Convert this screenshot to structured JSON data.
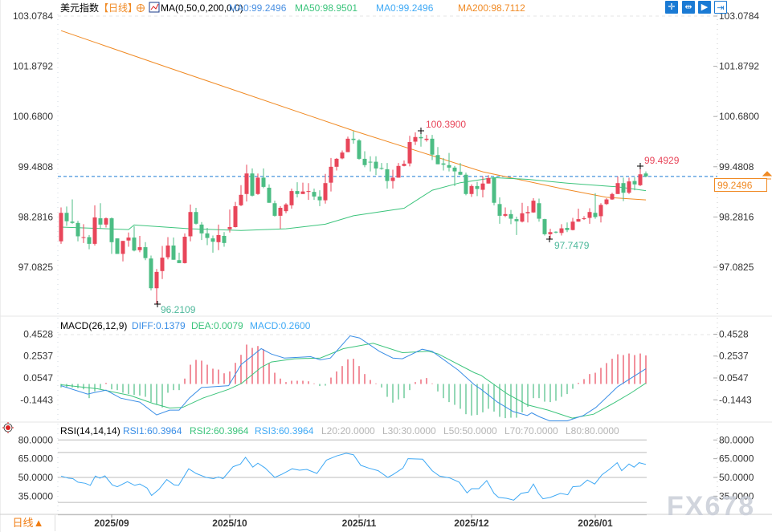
{
  "header": {
    "symbol": "美元指数",
    "period_tag": "【日线】",
    "ma_label": "MA(0,50,0,200,0,0)",
    "ma0": "MA0:99.2496",
    "ma50": "MA50:98.9501",
    "ma0b": "MA0:99.2496",
    "ma200": "MA200:98.7112"
  },
  "toolbar": {
    "icons": [
      "crosshair-icon",
      "fit-range-icon",
      "zoom-right-icon",
      "jump-latest-icon"
    ]
  },
  "colors": {
    "up": "#e8465a",
    "down": "#4cbd84",
    "ma50": "#3cc47c",
    "ma200": "#f08a24",
    "diff": "#3a8ee6",
    "dea": "#3cc47c",
    "rsi": "#3fa9f5",
    "price_line": "#1a7ad4"
  },
  "price_axis": {
    "labels": [
      "103.0784",
      "101.8792",
      "100.6800",
      "99.4808",
      "98.2816",
      "97.0825"
    ],
    "values": [
      103.0784,
      101.8792,
      100.68,
      99.4808,
      98.2816,
      97.0825
    ]
  },
  "current_price": "99.2496",
  "annotations": {
    "high": "100.3900",
    "low": "96.2109",
    "recent_high": "99.4929",
    "recent_low": "97.7479"
  },
  "macd": {
    "title": "MACD(26,12,9)",
    "diff_label": "DIFF:0.1379",
    "dea_label": "DEA:0.0079",
    "macd_label": "MACD:0.2600",
    "axis": {
      "labels": [
        "0.4528",
        "0.2537",
        "0.0547",
        "-0.1443"
      ],
      "values": [
        0.4528,
        0.2537,
        0.0547,
        -0.1443
      ]
    }
  },
  "rsi": {
    "title": "RSI(14,14,14)",
    "rsi1": "RSI1:60.3964",
    "rsi2": "RSI2:60.3964",
    "rsi3": "RSI3:60.3964",
    "l20": "L20:20.0000",
    "l30": "L30:30.0000",
    "l50": "L50:50.0000",
    "l70": "L70:70.0000",
    "l80": "L80:80.0000",
    "axis": {
      "labels": [
        "80.0000",
        "65.0000",
        "50.0000",
        "35.0000"
      ],
      "values": [
        80,
        65,
        50,
        35
      ]
    },
    "levels": [
      80,
      70,
      50,
      30,
      20
    ]
  },
  "footer": {
    "period": "日线",
    "period_arrow": "▲"
  },
  "date_ticks": [
    {
      "label": "2025/09",
      "index": 10
    },
    {
      "label": "2025/10",
      "index": 31
    },
    {
      "label": "2025/11",
      "index": 54
    },
    {
      "label": "2025/12",
      "index": 74
    },
    {
      "label": "2026/01",
      "index": 96
    }
  ],
  "watermark": "FX678",
  "chart_data": {
    "type": "candlestick",
    "ylim": [
      96.0,
      103.0784
    ],
    "candles_ohlc": [
      [
        97.7,
        98.51,
        97.64,
        98.38
      ],
      [
        98.38,
        98.53,
        98.07,
        98.18
      ],
      [
        98.17,
        98.7,
        98.12,
        98.14
      ],
      [
        98.14,
        98.19,
        97.7,
        97.82
      ],
      [
        97.8,
        98.11,
        97.66,
        97.8
      ],
      [
        97.8,
        97.85,
        97.51,
        97.64
      ],
      [
        97.64,
        98.56,
        97.6,
        98.27
      ],
      [
        98.25,
        98.61,
        98.0,
        98.1
      ],
      [
        98.1,
        98.27,
        98.03,
        98.25
      ],
      [
        98.25,
        98.27,
        97.4,
        97.68
      ],
      [
        97.77,
        97.77,
        97.4,
        97.4
      ],
      [
        97.4,
        97.71,
        97.22,
        97.71
      ],
      [
        97.72,
        97.91,
        97.57,
        97.79
      ],
      [
        97.79,
        98.06,
        97.46,
        97.48
      ],
      [
        97.49,
        97.83,
        97.44,
        97.56
      ],
      [
        97.56,
        97.68,
        97.25,
        97.3
      ],
      [
        97.29,
        97.36,
        96.53,
        96.58
      ],
      [
        96.58,
        97.04,
        96.21,
        96.97
      ],
      [
        96.99,
        97.59,
        96.8,
        97.31
      ],
      [
        97.32,
        97.8,
        97.27,
        97.6
      ],
      [
        97.6,
        97.79,
        97.26,
        97.26
      ],
      [
        97.25,
        97.43,
        97.18,
        97.18
      ],
      [
        97.18,
        97.89,
        97.17,
        97.81
      ],
      [
        97.82,
        98.58,
        97.7,
        98.4
      ],
      [
        98.4,
        98.5,
        98.1,
        98.12
      ],
      [
        98.1,
        98.16,
        97.73,
        97.89
      ],
      [
        97.89,
        98.02,
        97.61,
        97.78
      ],
      [
        97.77,
        97.84,
        97.43,
        97.69
      ],
      [
        97.68,
        98.1,
        97.49,
        97.85
      ],
      [
        97.83,
        97.92,
        97.57,
        97.66
      ],
      [
        97.99,
        98.46,
        97.91,
        98.04
      ],
      [
        98.04,
        98.64,
        98.03,
        98.54
      ],
      [
        98.56,
        99.04,
        98.54,
        98.81
      ],
      [
        98.83,
        99.53,
        98.65,
        99.32
      ],
      [
        99.32,
        99.44,
        98.77,
        98.79
      ],
      [
        98.83,
        99.32,
        98.81,
        99.22
      ],
      [
        99.22,
        99.44,
        98.97,
        99.0
      ],
      [
        98.98,
        99.06,
        98.62,
        98.62
      ],
      [
        98.61,
        98.67,
        98.29,
        98.31
      ],
      [
        98.31,
        98.54,
        98.0,
        98.5
      ],
      [
        98.42,
        98.61,
        98.37,
        98.58
      ],
      [
        98.56,
        98.96,
        98.48,
        98.9
      ],
      [
        98.9,
        99.11,
        98.75,
        98.83
      ],
      [
        98.83,
        99.1,
        98.83,
        98.89
      ],
      [
        98.88,
        99.09,
        98.69,
        98.9
      ],
      [
        98.88,
        98.96,
        98.69,
        98.77
      ],
      [
        98.77,
        98.92,
        98.54,
        98.68
      ],
      [
        98.68,
        99.31,
        98.6,
        99.09
      ],
      [
        99.1,
        99.69,
        98.89,
        99.48
      ],
      [
        99.48,
        99.69,
        99.39,
        99.67
      ],
      [
        99.68,
        99.87,
        99.66,
        99.82
      ],
      [
        99.83,
        100.2,
        99.83,
        100.15
      ],
      [
        100.15,
        100.33,
        100.03,
        100.12
      ],
      [
        100.11,
        100.14,
        99.65,
        99.67
      ],
      [
        99.67,
        99.85,
        99.47,
        99.52
      ],
      [
        99.6,
        99.73,
        99.37,
        99.59
      ],
      [
        99.6,
        99.73,
        99.28,
        99.44
      ],
      [
        99.45,
        99.57,
        99.41,
        99.43
      ],
      [
        99.42,
        99.57,
        98.96,
        99.14
      ],
      [
        99.14,
        99.41,
        98.96,
        99.22
      ],
      [
        99.22,
        99.57,
        99.22,
        99.5
      ],
      [
        99.5,
        99.63,
        99.49,
        99.55
      ],
      [
        99.56,
        100.22,
        99.49,
        100.07
      ],
      [
        100.08,
        100.3,
        100.0,
        100.19
      ],
      [
        100.19,
        100.39,
        99.96,
        100.16
      ],
      [
        100.12,
        100.24,
        100.08,
        100.15
      ],
      [
        100.15,
        100.24,
        99.64,
        99.77
      ],
      [
        99.76,
        99.95,
        99.54,
        99.54
      ],
      [
        99.56,
        99.69,
        99.39,
        99.53
      ],
      [
        99.52,
        99.81,
        99.37,
        99.46
      ],
      [
        99.46,
        99.5,
        99.02,
        99.37
      ],
      [
        99.36,
        99.57,
        99.28,
        99.29
      ],
      [
        99.29,
        99.34,
        98.8,
        98.83
      ],
      [
        98.83,
        99.06,
        98.76,
        99.02
      ],
      [
        99.02,
        99.12,
        98.78,
        98.95
      ],
      [
        98.93,
        99.25,
        98.75,
        99.08
      ],
      [
        99.08,
        99.28,
        99.08,
        99.21
      ],
      [
        99.21,
        99.23,
        98.56,
        98.62
      ],
      [
        98.59,
        98.75,
        98.12,
        98.31
      ],
      [
        98.31,
        98.51,
        98.28,
        98.35
      ],
      [
        98.35,
        98.45,
        98.11,
        98.24
      ],
      [
        98.23,
        98.29,
        97.85,
        98.18
      ],
      [
        98.17,
        98.62,
        98.15,
        98.37
      ],
      [
        98.37,
        98.54,
        98.15,
        98.4
      ],
      [
        98.39,
        98.73,
        98.38,
        98.67
      ],
      [
        98.61,
        98.72,
        98.17,
        98.24
      ],
      [
        98.23,
        98.24,
        97.84,
        97.87
      ],
      [
        97.87,
        98.0,
        97.7479,
        97.92
      ],
      [
        97.93,
        97.94,
        97.89,
        97.91
      ],
      [
        97.9,
        98.11,
        97.84,
        98.01
      ],
      [
        98.02,
        98.15,
        97.92,
        97.97
      ],
      [
        97.97,
        98.26,
        97.96,
        98.17
      ],
      [
        98.17,
        98.48,
        98.17,
        98.23
      ],
      [
        98.23,
        98.3,
        98.21,
        98.25
      ],
      [
        98.26,
        98.49,
        98.12,
        98.4
      ],
      [
        98.38,
        98.85,
        98.24,
        98.28
      ],
      [
        98.3,
        98.61,
        98.15,
        98.57
      ],
      [
        98.59,
        98.73,
        98.57,
        98.7
      ],
      [
        98.7,
        98.86,
        98.69,
        98.83
      ],
      [
        98.83,
        99.25,
        98.83,
        99.09
      ],
      [
        99.09,
        99.22,
        98.66,
        98.86
      ],
      [
        98.86,
        99.22,
        98.83,
        99.13
      ],
      [
        99.14,
        99.23,
        98.92,
        99.06
      ],
      [
        99.04,
        99.4929,
        99.02,
        99.3
      ],
      [
        99.32,
        99.37,
        99.23,
        99.2496
      ]
    ],
    "ma50_points": [
      [
        1,
        98.04
      ],
      [
        13,
        97.98
      ],
      [
        14,
        98.09
      ],
      [
        24,
        98.0
      ],
      [
        33,
        97.96
      ],
      [
        41,
        98.0
      ],
      [
        48,
        98.11
      ],
      [
        53,
        98.31
      ],
      [
        62,
        98.49
      ],
      [
        67,
        98.92
      ],
      [
        72,
        99.1
      ],
      [
        78,
        99.22
      ],
      [
        84,
        99.18
      ],
      [
        91,
        99.09
      ],
      [
        100,
        99.0
      ],
      [
        105,
        98.91
      ]
    ],
    "ma200_points": [
      [
        1,
        102.73
      ],
      [
        20,
        101.85
      ],
      [
        53,
        100.34
      ],
      [
        76,
        99.36
      ],
      [
        90,
        98.96
      ],
      [
        98,
        98.75
      ],
      [
        105,
        98.69
      ]
    ],
    "macd_hist": [
      -0.032,
      -0.032,
      -0.032,
      -0.039,
      -0.049,
      -0.129,
      -0.068,
      -0.044,
      0.01,
      -0.049,
      -0.056,
      -0.08,
      -0.092,
      -0.1,
      -0.105,
      -0.117,
      -0.165,
      -0.19,
      -0.214,
      -0.08,
      -0.056,
      -0.056,
      0.049,
      0.175,
      0.219,
      0.212,
      0.175,
      0.139,
      0.131,
      0.097,
      0.114,
      0.192,
      0.265,
      0.358,
      0.328,
      0.345,
      0.316,
      0.187,
      0.102,
      0.049,
      0.017,
      0.029,
      0.029,
      0.029,
      0.024,
      0.005,
      -0.019,
      -0.015,
      0.058,
      0.114,
      0.163,
      0.224,
      0.229,
      0.163,
      0.09,
      0.036,
      0.005,
      -0.032,
      -0.117,
      -0.17,
      -0.141,
      -0.129,
      -0.056,
      0.017,
      0.041,
      0.054,
      0.005,
      -0.068,
      -0.129,
      -0.165,
      -0.19,
      -0.226,
      -0.275,
      -0.287,
      -0.282,
      -0.258,
      -0.226,
      -0.251,
      -0.299,
      -0.311,
      -0.307,
      -0.307,
      -0.258,
      -0.209,
      -0.129,
      -0.129,
      -0.161,
      -0.165,
      -0.153,
      -0.117,
      -0.092,
      -0.044,
      0.01,
      0.044,
      0.09,
      0.102,
      0.146,
      0.19,
      0.229,
      0.27,
      0.263,
      0.277,
      0.263,
      0.277,
      0.26
    ],
    "diff_points": [
      [
        1,
        -0.015
      ],
      [
        5.7,
        -0.092
      ],
      [
        9,
        -0.056
      ],
      [
        11.6,
        -0.129
      ],
      [
        15,
        -0.165
      ],
      [
        18,
        -0.282
      ],
      [
        20.3,
        -0.238
      ],
      [
        22,
        -0.238
      ],
      [
        23.8,
        -0.129
      ],
      [
        26,
        -0.032
      ],
      [
        30.8,
        -0.015
      ],
      [
        33,
        0.175
      ],
      [
        36.6,
        0.321
      ],
      [
        38.4,
        0.272
      ],
      [
        40.7,
        0.236
      ],
      [
        45.4,
        0.248
      ],
      [
        47.1,
        0.219
      ],
      [
        48.9,
        0.236
      ],
      [
        52.4,
        0.438
      ],
      [
        54.1,
        0.418
      ],
      [
        57.6,
        0.297
      ],
      [
        60,
        0.236
      ],
      [
        61.7,
        0.229
      ],
      [
        65.2,
        0.316
      ],
      [
        67,
        0.297
      ],
      [
        71.6,
        0.127
      ],
      [
        74.5,
        -0.007
      ],
      [
        75.7,
        -0.049
      ],
      [
        78.6,
        -0.165
      ],
      [
        81.4,
        -0.251
      ],
      [
        83.9,
        -0.287
      ],
      [
        84.7,
        -0.263
      ],
      [
        86.1,
        -0.299
      ],
      [
        87.9,
        -0.336
      ],
      [
        91,
        -0.336
      ],
      [
        93.9,
        -0.287
      ],
      [
        96.1,
        -0.214
      ],
      [
        100,
        -0.024
      ],
      [
        102.4,
        0.054
      ],
      [
        105,
        0.1379
      ]
    ],
    "dea_points": [
      [
        1,
        -0.007
      ],
      [
        7.5,
        -0.044
      ],
      [
        13.3,
        -0.105
      ],
      [
        17.4,
        -0.178
      ],
      [
        20.3,
        -0.219
      ],
      [
        22.6,
        -0.214
      ],
      [
        26.2,
        -0.129
      ],
      [
        30.8,
        -0.049
      ],
      [
        33.1,
        0.005
      ],
      [
        36.6,
        0.151
      ],
      [
        38.4,
        0.2
      ],
      [
        42.5,
        0.229
      ],
      [
        47.1,
        0.236
      ],
      [
        51.2,
        0.321
      ],
      [
        56.5,
        0.37
      ],
      [
        61.7,
        0.285
      ],
      [
        66.4,
        0.297
      ],
      [
        68.1,
        0.272
      ],
      [
        74.5,
        0.102
      ],
      [
        75.7,
        0.078
      ],
      [
        80.4,
        -0.092
      ],
      [
        83.9,
        -0.19
      ],
      [
        87.6,
        -0.238
      ],
      [
        91.9,
        -0.311
      ],
      [
        95.7,
        -0.275
      ],
      [
        99.6,
        -0.165
      ],
      [
        102.4,
        -0.08
      ],
      [
        105,
        0.0079
      ]
    ],
    "rsi_points": [
      [
        1,
        51.1
      ],
      [
        2.3,
        49.4
      ],
      [
        3.1,
        49.0
      ],
      [
        4,
        46.2
      ],
      [
        5.3,
        45.3
      ],
      [
        6.2,
        43.6
      ],
      [
        7.1,
        51.1
      ],
      [
        7.9,
        49.4
      ],
      [
        8.8,
        51.3
      ],
      [
        10.1,
        44.0
      ],
      [
        11,
        42.5
      ],
      [
        12.8,
        46.6
      ],
      [
        14.1,
        43.6
      ],
      [
        15,
        44.7
      ],
      [
        16.3,
        41.5
      ],
      [
        17.1,
        35.5
      ],
      [
        18.4,
        40.4
      ],
      [
        19.8,
        48.3
      ],
      [
        21.1,
        44.0
      ],
      [
        21.9,
        43.6
      ],
      [
        23.7,
        56.9
      ],
      [
        25,
        53.2
      ],
      [
        26.8,
        50.0
      ],
      [
        28.1,
        49.0
      ],
      [
        29,
        50.4
      ],
      [
        29.8,
        49.0
      ],
      [
        31.6,
        58.6
      ],
      [
        32.9,
        60.7
      ],
      [
        33.8,
        66.1
      ],
      [
        35.1,
        58.2
      ],
      [
        36,
        61.4
      ],
      [
        37.3,
        57.5
      ],
      [
        39,
        50.0
      ],
      [
        40.3,
        52.6
      ],
      [
        42.1,
        56.9
      ],
      [
        43.4,
        55.8
      ],
      [
        44.7,
        56.4
      ],
      [
        46.5,
        53.2
      ],
      [
        48.2,
        63.9
      ],
      [
        50,
        67.2
      ],
      [
        51.7,
        69.3
      ],
      [
        53,
        68.2
      ],
      [
        54.3,
        59.7
      ],
      [
        55.7,
        57.5
      ],
      [
        57.4,
        55.4
      ],
      [
        59.1,
        50.0
      ],
      [
        60,
        52.2
      ],
      [
        61.8,
        57.5
      ],
      [
        62.7,
        65.0
      ],
      [
        65.3,
        64.6
      ],
      [
        67,
        55.4
      ],
      [
        68.3,
        51.1
      ],
      [
        70.1,
        49.6
      ],
      [
        71.8,
        46.2
      ],
      [
        73.2,
        37.6
      ],
      [
        74,
        41.0
      ],
      [
        75.3,
        41.0
      ],
      [
        76.7,
        47.5
      ],
      [
        78,
        37.2
      ],
      [
        78.8,
        34.0
      ],
      [
        80.2,
        33.3
      ],
      [
        81.5,
        31.8
      ],
      [
        82.8,
        37.2
      ],
      [
        84.1,
        38.2
      ],
      [
        85,
        44.7
      ],
      [
        85.9,
        37.2
      ],
      [
        86.7,
        32.9
      ],
      [
        88,
        34.0
      ],
      [
        89.8,
        37.2
      ],
      [
        91.1,
        36.1
      ],
      [
        92,
        42.5
      ],
      [
        93.3,
        43.0
      ],
      [
        94.6,
        47.9
      ],
      [
        95.9,
        44.7
      ],
      [
        97.2,
        52.2
      ],
      [
        98.5,
        56.4
      ],
      [
        99.9,
        61.8
      ],
      [
        100.7,
        55.4
      ],
      [
        102,
        60.7
      ],
      [
        102.9,
        58.2
      ],
      [
        103.8,
        61.8
      ],
      [
        105,
        60.3964
      ]
    ]
  }
}
